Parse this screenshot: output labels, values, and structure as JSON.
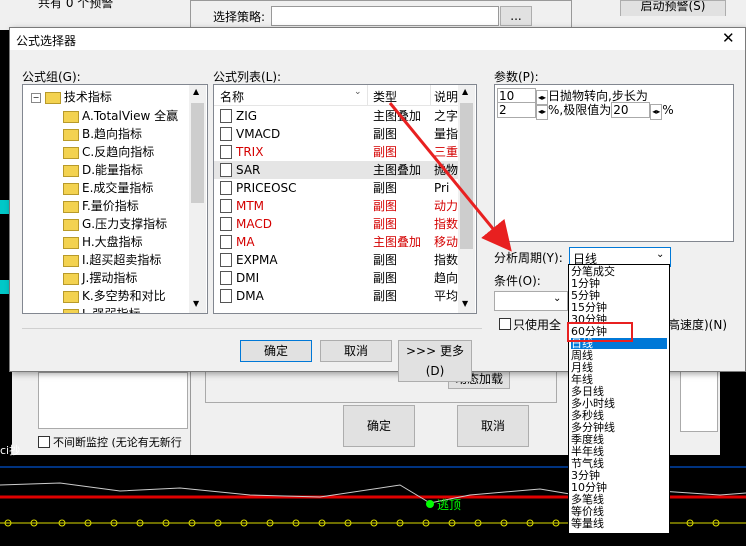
{
  "background": {
    "top_text": "共有 0 个预警",
    "strategy_label": "选择策略:",
    "browse_button": "...",
    "start_alert_button": "启动预警(S)",
    "dynamic_load_button": "动态加载",
    "ok_button": "确定",
    "cancel_button": "取消",
    "continuous_monitor": "不间断监控 (无论有无新行",
    "chart_label_left": "ci抄",
    "chart_label_right": "逃顶"
  },
  "dialog": {
    "title": "公式选择器",
    "close_label": "✕",
    "group_label": "公式组(G):",
    "list_label": "公式列表(L):",
    "params_label": "参数(P):",
    "tree": {
      "root": "技术指标",
      "items": [
        "A.TotalView 全赢",
        "B.趋向指标",
        "C.反趋向指标",
        "D.能量指标",
        "E.成交量指标",
        "F.量价指标",
        "G.压力支撑指标",
        "H.大盘指标",
        "I.超买超卖指标",
        "J.摆动指标",
        "K.多空势和对比",
        "L.强弱指标"
      ]
    },
    "list": {
      "headers": [
        "名称",
        "类型",
        "说明"
      ],
      "rows": [
        {
          "name": "ZIG",
          "type": "主图叠加",
          "desc": "之字",
          "red": false
        },
        {
          "name": "VMACD",
          "type": "副图",
          "desc": "量指",
          "red": false
        },
        {
          "name": "TRIX",
          "type": "副图",
          "desc": "三重",
          "red": true
        },
        {
          "name": "SAR",
          "type": "主图叠加",
          "desc": "抛物",
          "red": false,
          "selected": true
        },
        {
          "name": "PRICEOSC",
          "type": "副图",
          "desc": "Pri",
          "red": false
        },
        {
          "name": "MTM",
          "type": "副图",
          "desc": "动力",
          "red": true
        },
        {
          "name": "MACD",
          "type": "副图",
          "desc": "指数",
          "red": true
        },
        {
          "name": "MA",
          "type": "主图叠加",
          "desc": "移动",
          "red": true
        },
        {
          "name": "EXPMA",
          "type": "副图",
          "desc": "指数",
          "red": false
        },
        {
          "name": "DMI",
          "type": "副图",
          "desc": "趋向",
          "red": false
        },
        {
          "name": "DMA",
          "type": "副图",
          "desc": "平均",
          "red": false
        }
      ]
    },
    "params": {
      "p1_value": "10",
      "p1_text": "日抛物转向,步长为",
      "p2_value": "2",
      "p2_text": "%,极限值为",
      "p3_value": "20",
      "p3_text": "%"
    },
    "period_label": "分析周期(Y):",
    "period_selected": "日线",
    "condition_label": "条件(O):",
    "only_use_label": "只使用全",
    "speed_label": "高速度)(N)",
    "ok_button": "确定",
    "cancel_button": "取消",
    "more_button": ">>> 更多(D)"
  },
  "period_dropdown": {
    "options": [
      "分笔成交",
      "1分钟",
      "5分钟",
      "15分钟",
      "30分钟",
      "60分钟",
      "日线",
      "周线",
      "月线",
      "年线",
      "多日线",
      "多小时线",
      "多秒线",
      "多分钟线",
      "季度线",
      "半年线",
      "节气线",
      "3分钟",
      "10分钟",
      "多笔线",
      "等价线",
      "等量线"
    ],
    "highlighted": "60分钟",
    "selected": "日线"
  },
  "colors": {
    "selection": "#0078d7",
    "highlight_box": "#e82020",
    "arrow": "#e82020",
    "formula_red": "#d40000"
  }
}
